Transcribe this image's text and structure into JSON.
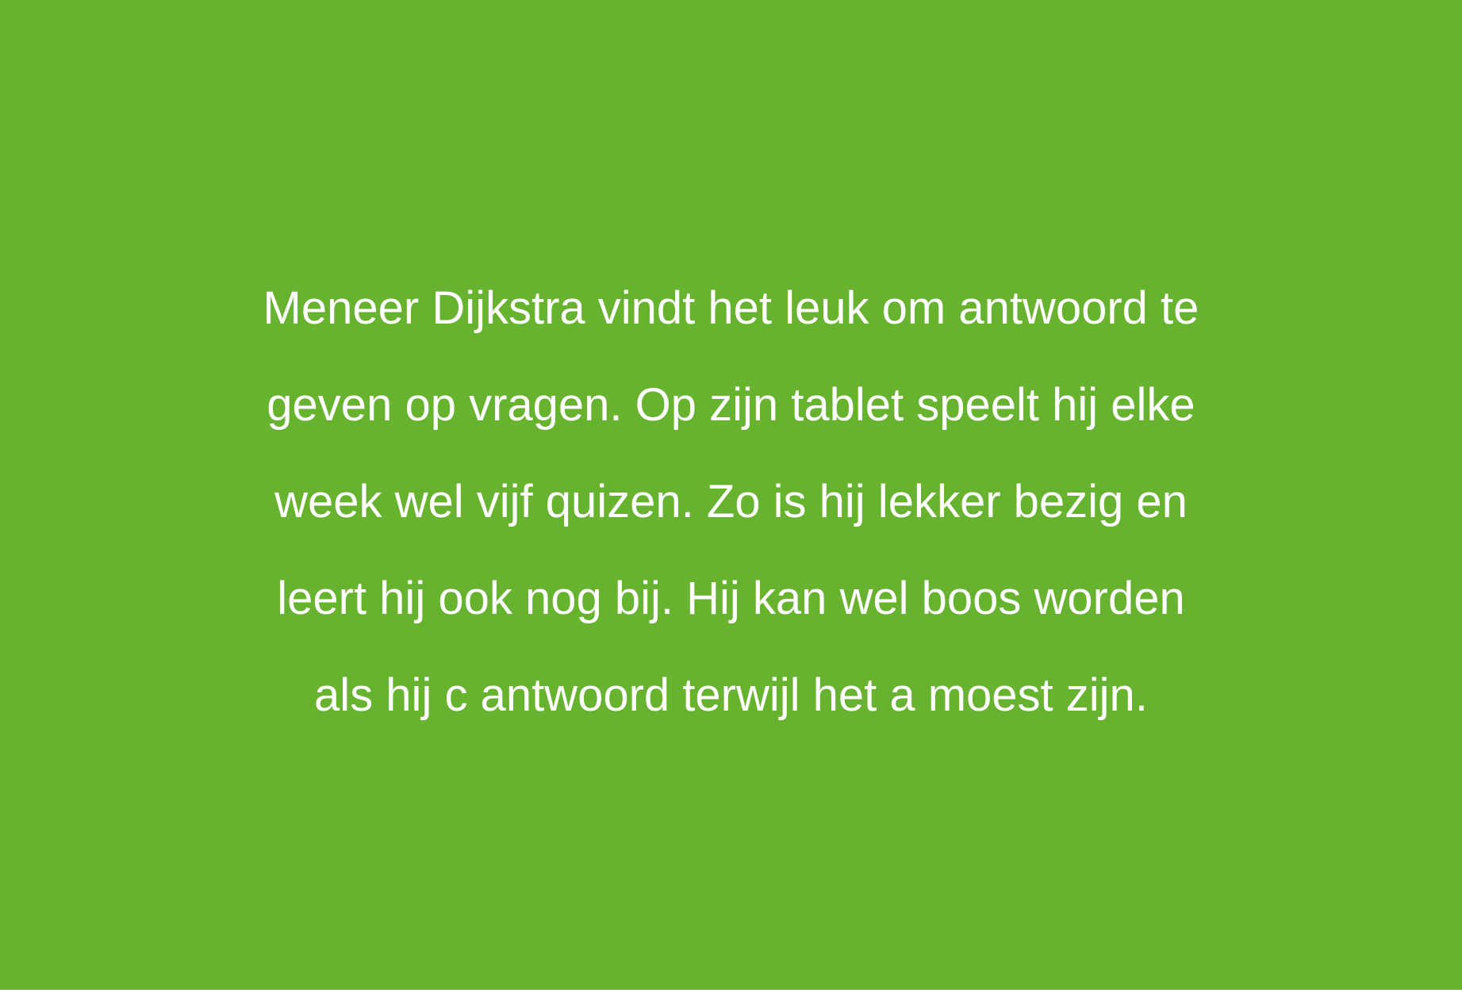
{
  "slide": {
    "background_color": "#67b32f",
    "text_color": "#ffffff",
    "lines": [
      "Meneer Dijkstra vindt het leuk om antwoord te",
      "geven op vragen. Op zijn tablet speelt hij elke",
      "week wel vijf quizen. Zo is hij lekker bezig en",
      "leert hij ook nog bij. Hij kan wel boos worden",
      "als hij c antwoord terwijl het a moest zijn."
    ]
  }
}
